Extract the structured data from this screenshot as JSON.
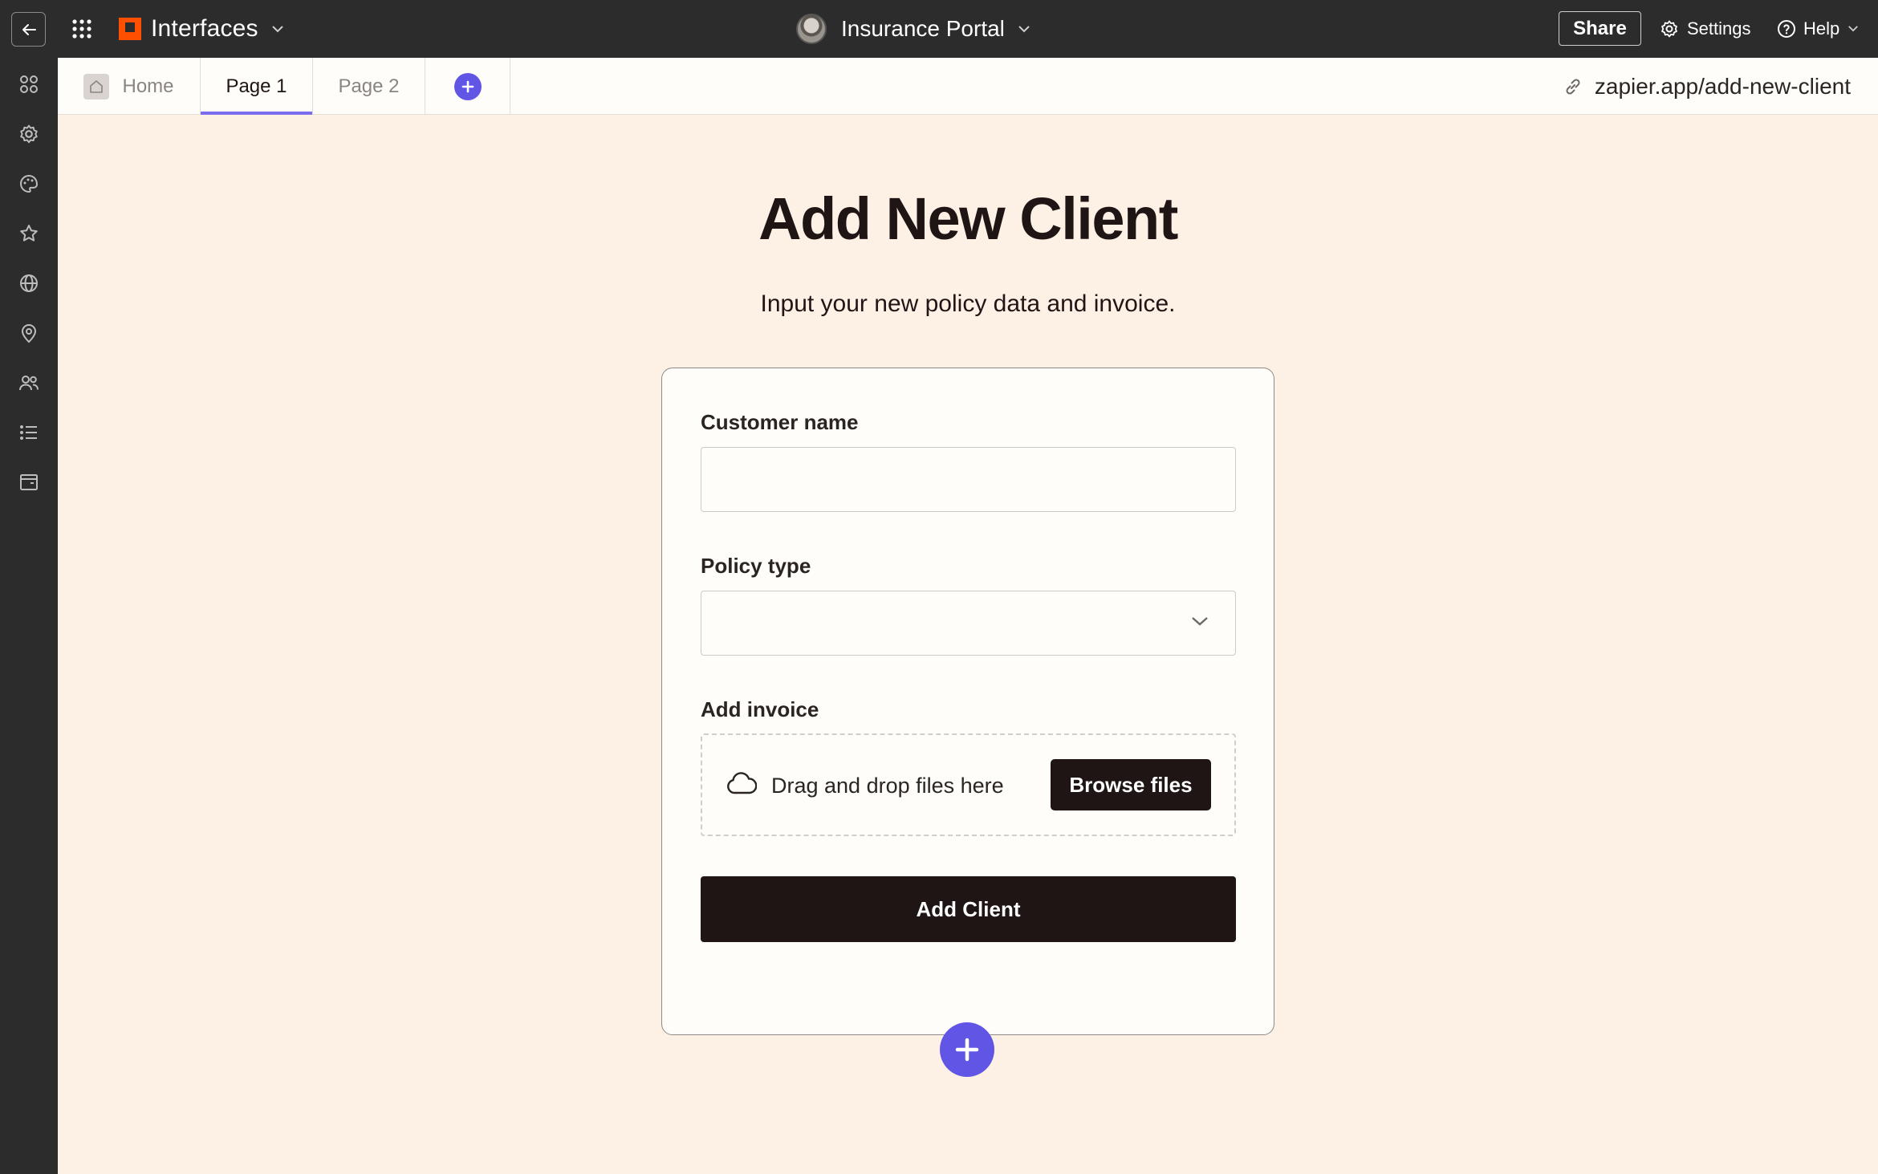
{
  "topbar": {
    "app_name": "Interfaces",
    "project_name": "Insurance Portal",
    "share_label": "Share",
    "settings_label": "Settings",
    "help_label": "Help"
  },
  "sidebar": {
    "icons": [
      "components-icon",
      "gear-icon",
      "palette-icon",
      "star-icon",
      "globe-icon",
      "location-pin-icon",
      "users-icon",
      "list-icon",
      "archive-icon"
    ]
  },
  "tabs": {
    "home_label": "Home",
    "page1_label": "Page 1",
    "page2_label": "Page 2",
    "active": "Page 1"
  },
  "url": "zapier.app/add-new-client",
  "page": {
    "title": "Add New Client",
    "subtitle": "Input your new policy data and invoice."
  },
  "form": {
    "customer_name_label": "Customer name",
    "customer_name_value": "",
    "policy_type_label": "Policy type",
    "policy_type_value": "",
    "invoice_label": "Add invoice",
    "dropzone_text": "Drag and drop files here",
    "browse_label": "Browse files",
    "submit_label": "Add Client"
  },
  "colors": {
    "accent": "#6155e6",
    "tab_underline": "#7b6cf0",
    "brand": "#ff4f00",
    "page_bg": "#fdf1e6",
    "dark": "#201515"
  }
}
